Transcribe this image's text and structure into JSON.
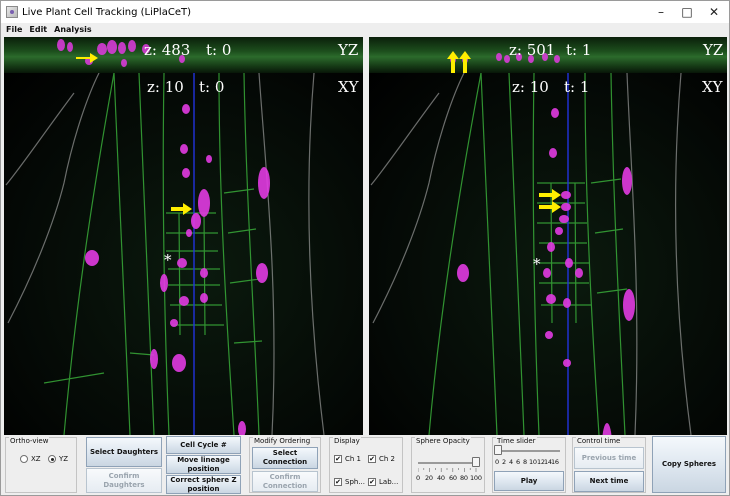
{
  "window": {
    "title": "Live Plant Cell Tracking (LiPlaCeT)",
    "minimize_icon": "minimize-icon",
    "maximize_icon": "maximize-icon",
    "close_icon": "close-icon"
  },
  "menu": [
    "File",
    "Edit",
    "Analysis"
  ],
  "left_view": {
    "yz_z": "z: 483",
    "yz_t": "t: 0",
    "yz_label": "YZ",
    "xy_z": "z: 10",
    "xy_t": "t: 0",
    "xy_label": "XY",
    "asterisk": "*"
  },
  "right_view": {
    "yz_z": "z: 501",
    "yz_t": "t: 1",
    "yz_label": "YZ",
    "xy_z": "z: 10",
    "xy_t": "t: 1",
    "xy_label": "XY",
    "asterisk": "*"
  },
  "colors": {
    "membrane": "#3fbf3f",
    "nucleus": "#e23be2",
    "arrow": "#ffee00",
    "slice_line": "#2233dd",
    "cell_wall": "#cfcfcf"
  },
  "controls": {
    "ortho": {
      "title": "Ortho-view",
      "xz": "XZ",
      "yz": "YZ",
      "selected": "YZ"
    },
    "daughters": {
      "select": "Select Daughters",
      "confirm": "Confirm Daughters"
    },
    "cell": {
      "cycle": "Cell Cycle #",
      "move_lineage": "Move lineage position",
      "correct_sphere": "Correct sphere Z position"
    },
    "modify_ordering": {
      "title": "Modify Ordering",
      "select": "Select Connection",
      "confirm": "Confirm Connection"
    },
    "display": {
      "title": "Display",
      "ch1": "Ch 1",
      "ch2": "Ch 2",
      "sph": "Sph...",
      "lab": "Lab...",
      "ch1_checked": true,
      "ch2_checked": true,
      "sph_checked": true,
      "lab_checked": true
    },
    "sphere_opacity": {
      "title": "Sphere Opacity",
      "ticks": [
        "0",
        "20",
        "40",
        "60",
        "80",
        "100"
      ],
      "value": 100
    },
    "time_slider": {
      "title": "Time slider",
      "ticks": [
        "0",
        "2",
        "4",
        "6",
        "8",
        "10",
        "12",
        "14",
        "16"
      ],
      "value": 0,
      "play": "Play"
    },
    "control_time": {
      "title": "Control time",
      "previous": "Previous time",
      "next": "Next time"
    },
    "copy": "Copy Spheres"
  }
}
